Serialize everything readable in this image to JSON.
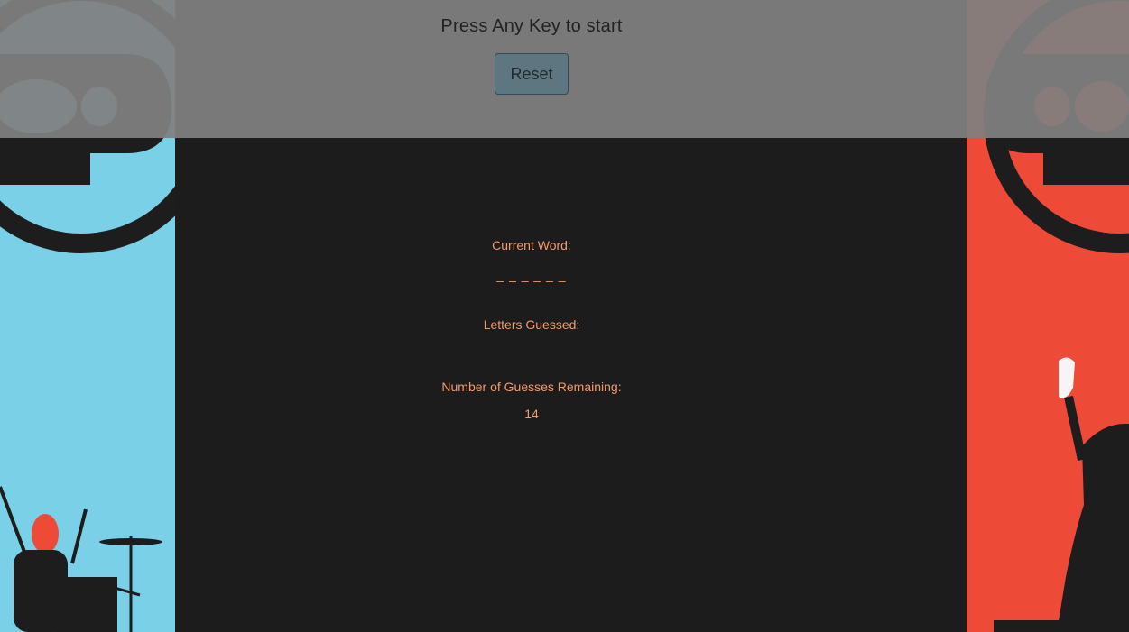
{
  "header": {
    "prompt": "Press Any Key to start",
    "reset_label": "Reset"
  },
  "game": {
    "current_word_label": "Current Word:",
    "current_word": "_ _ _ _ _ _",
    "letters_guessed_label": "Letters Guessed:",
    "letters_guessed": "",
    "guesses_remaining_label": "Number of Guesses Remaining:",
    "guesses_remaining": "14"
  },
  "colors": {
    "left_panel": "#7ad0e6",
    "right_panel": "#ee4a38",
    "background": "#1c1c1c",
    "game_text": "#f39a6a",
    "overlay": "#808080",
    "button": "#5d7680"
  },
  "icons": {
    "left_art": "drummer-silhouette-with-mask",
    "right_art": "singer-silhouette-holding-mask"
  }
}
